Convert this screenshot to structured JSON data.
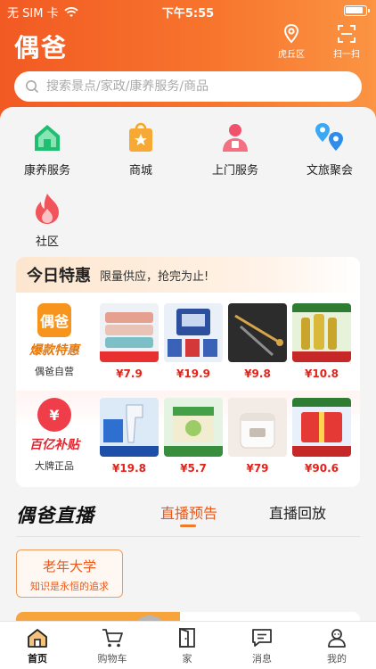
{
  "status_bar": {
    "carrier": "无 SIM 卡",
    "time": "下午5:55",
    "battery_level": 0.9
  },
  "header": {
    "logo": "偶爸",
    "location_label": "虎丘区",
    "scan_label": "扫一扫",
    "search_placeholder": "搜索景点/家政/康养服务/商品"
  },
  "services": [
    {
      "label": "康养服务",
      "icon": "house-care-icon"
    },
    {
      "label": "商城",
      "icon": "shopping-bag-icon"
    },
    {
      "label": "上门服务",
      "icon": "service-person-icon"
    },
    {
      "label": "文旅聚会",
      "icon": "map-pins-icon"
    },
    {
      "label": "社区",
      "icon": "flame-icon"
    }
  ],
  "deals": {
    "title": "今日特惠",
    "subtitle": "限量供应，抢完为止!",
    "rows": [
      {
        "badge": "偶爸",
        "slogan": "爆款特惠",
        "name": "偶爸自营",
        "products": [
          {
            "price": "¥7.9",
            "icon": "towel-product"
          },
          {
            "price": "¥19.9",
            "icon": "oatmeal-product"
          },
          {
            "price": "¥9.8",
            "icon": "back-scratcher-product"
          },
          {
            "price": "¥10.8",
            "icon": "oil-bottles-product"
          }
        ]
      },
      {
        "badge": "¥",
        "slogan": "百亿补贴",
        "name": "大牌正品",
        "products": [
          {
            "price": "¥19.8",
            "icon": "thermometer-product"
          },
          {
            "price": "¥5.7",
            "icon": "food-pack-product"
          },
          {
            "price": "¥79",
            "icon": "rice-bucket-product"
          },
          {
            "price": "¥90.6",
            "icon": "gift-box-product"
          }
        ]
      }
    ]
  },
  "live": {
    "logo": "偶爸直播",
    "tabs": [
      "直播预告",
      "直播回放"
    ],
    "active_tab": 0
  },
  "course": {
    "title": "老年大学",
    "subtitle": "知识是永恒的追求"
  },
  "tabbar": [
    {
      "label": "首页",
      "icon": "home-icon",
      "active": true
    },
    {
      "label": "购物车",
      "icon": "cart-icon",
      "active": false
    },
    {
      "label": "家",
      "icon": "door-icon",
      "active": false
    },
    {
      "label": "消息",
      "icon": "message-icon",
      "active": false
    },
    {
      "label": "我的",
      "icon": "profile-icon",
      "active": false
    }
  ],
  "colors": {
    "brand": "#f25a23",
    "price": "#e2231a",
    "active_tab": "#e8591b"
  }
}
